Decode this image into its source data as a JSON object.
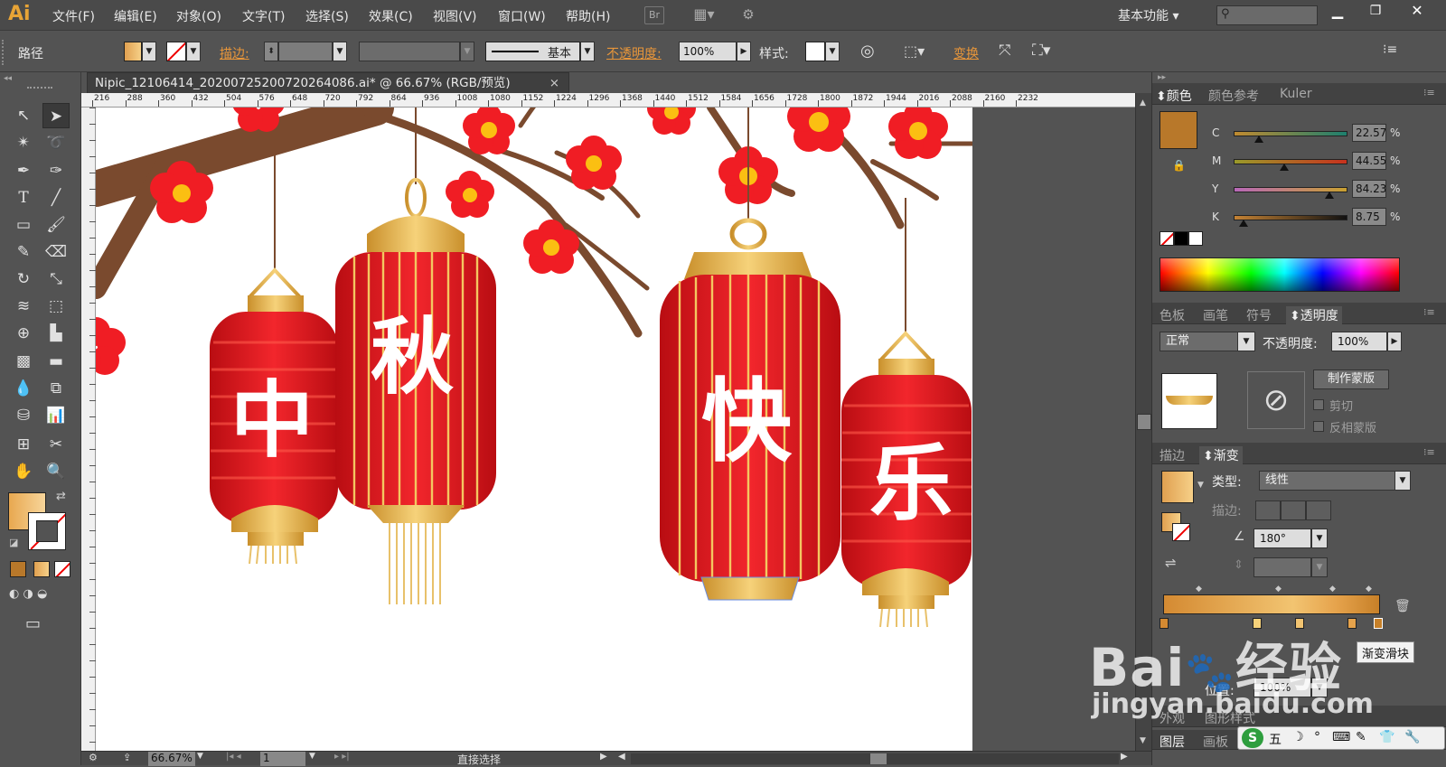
{
  "app": {
    "logo": "Ai",
    "workspace": "基本功能"
  },
  "menu": [
    "文件(F)",
    "编辑(E)",
    "对象(O)",
    "文字(T)",
    "选择(S)",
    "效果(C)",
    "视图(V)",
    "窗口(W)",
    "帮助(H)"
  ],
  "menu_icons": {
    "bridge": "Br"
  },
  "control": {
    "object_type": "路径",
    "stroke_label": "描边:",
    "stroke_style": "基本",
    "opacity_label": "不透明度:",
    "opacity_value": "100%",
    "style_label": "样式:",
    "transform_label": "变换"
  },
  "document": {
    "tab_title": "Nipic_12106414_20200725200720264086.ai* @ 66.67% (RGB/预览)",
    "close": "×",
    "ruler_ticks": [
      "216",
      "288",
      "360",
      "432",
      "504",
      "576",
      "648",
      "720",
      "792",
      "864",
      "936",
      "1008",
      "1080",
      "1152",
      "1224",
      "1296",
      "1368",
      "1440",
      "1512",
      "1584",
      "1656",
      "1728",
      "1800",
      "1872",
      "1944",
      "2016",
      "2088",
      "2160",
      "2232"
    ],
    "lantern_chars": [
      "中",
      "秋",
      "快",
      "乐"
    ]
  },
  "status": {
    "zoom": "66.67%",
    "artboard": "1",
    "tool": "直接选择"
  },
  "panels": {
    "color_tabs": [
      "颜色",
      "颜色参考",
      "Kuler"
    ],
    "cmyk": [
      {
        "label": "C",
        "value": "22.57",
        "level": 0.2257
      },
      {
        "label": "M",
        "value": "44.55",
        "level": 0.4455
      },
      {
        "label": "Y",
        "value": "84.23",
        "level": 0.8423
      },
      {
        "label": "K",
        "value": "8.75",
        "level": 0.0875
      }
    ],
    "percent": "%",
    "swatch_tabs": [
      "色板",
      "画笔",
      "符号",
      "透明度"
    ],
    "blend_mode": "正常",
    "opacity_label": "不透明度:",
    "opacity_value": "100%",
    "make_mask": "制作蒙版",
    "clip": "剪切",
    "invert_mask": "反相蒙版",
    "gradient_tabs": [
      "描边",
      "渐变"
    ],
    "type_label": "类型:",
    "type_value": "线性",
    "stroke_label": "描边:",
    "angle": "180°",
    "tooltip": "渐变滑块",
    "location_label": "位置:",
    "location_value": "100%",
    "bottom_tabs": [
      "外观",
      "图形样式"
    ],
    "layer_tabs": [
      "图层",
      "画板"
    ],
    "color_main": "#b8782a"
  },
  "watermark": {
    "brand": "Bai",
    "brand2": "经验",
    "url": "jingyan.baidu.com"
  },
  "ime": [
    "五",
    "☽",
    "°",
    "⌨",
    "✎",
    "👕",
    "🔧"
  ]
}
